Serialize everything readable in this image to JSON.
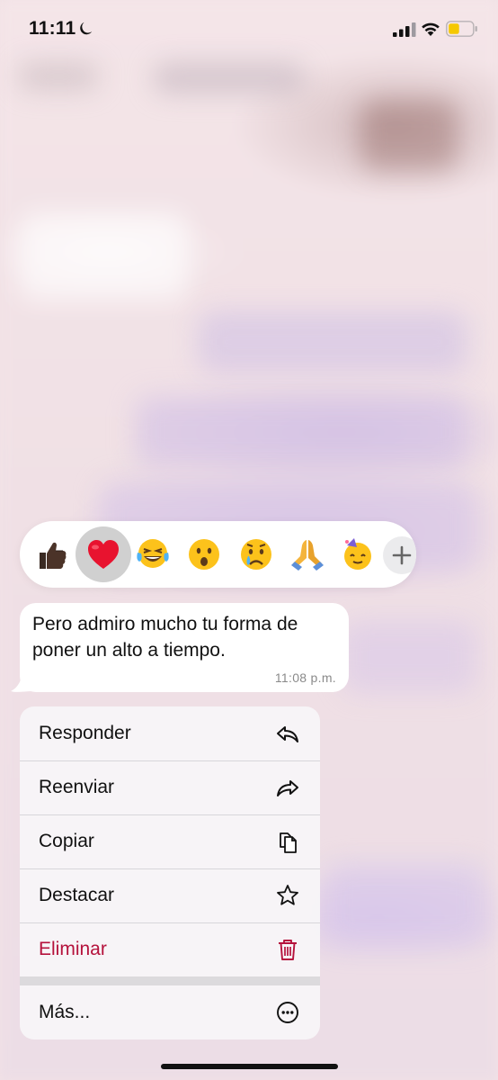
{
  "status_bar": {
    "time": "11:11",
    "focus_icon": "moon-icon",
    "battery_color": "#f5c800"
  },
  "reactions": {
    "items": [
      {
        "name": "thumbs-up-emoji",
        "glyph": "👍🏿"
      },
      {
        "name": "heart-emoji",
        "glyph": "❤️",
        "selected": true
      },
      {
        "name": "tears-of-joy-emoji",
        "glyph": "😂"
      },
      {
        "name": "surprised-emoji",
        "glyph": "😮"
      },
      {
        "name": "crying-emoji",
        "glyph": "😢"
      },
      {
        "name": "folded-hands-emoji",
        "glyph": "🙏"
      },
      {
        "name": "party-face-emoji",
        "glyph": "🥳"
      }
    ],
    "more_icon": "plus-icon"
  },
  "message": {
    "text": "Pero admiro mucho tu forma de poner un alto a tiempo.",
    "time": "11:08 p.m."
  },
  "menu": {
    "items": [
      {
        "label": "Responder",
        "icon": "reply-icon"
      },
      {
        "label": "Reenviar",
        "icon": "forward-icon"
      },
      {
        "label": "Copiar",
        "icon": "copy-icon"
      },
      {
        "label": "Destacar",
        "icon": "star-icon"
      },
      {
        "label": "Eliminar",
        "icon": "trash-icon",
        "color": "#b5123c"
      }
    ],
    "more": {
      "label": "Más...",
      "icon": "more-circle-icon"
    }
  }
}
